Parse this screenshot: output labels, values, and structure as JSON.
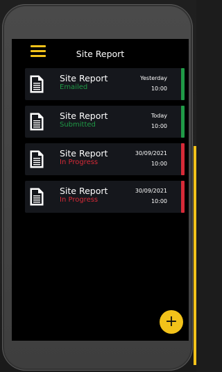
{
  "app_bar": {
    "title": "Site Report",
    "menu_icon": "hamburger-menu-icon"
  },
  "colors": {
    "accent": "#f2c21a",
    "status_complete": "#1f9a46",
    "status_in_progress": "#d62a37"
  },
  "reports": [
    {
      "title": "Site Report",
      "status": "Emailed",
      "status_color": "#1f9a46",
      "date": "Yesterday",
      "time": "10:00",
      "icon": "document-icon"
    },
    {
      "title": "Site Report",
      "status": "Submitted",
      "status_color": "#1f9a46",
      "date": "Today",
      "time": "10:00",
      "icon": "document-icon"
    },
    {
      "title": "Site Report",
      "status": "In Progress",
      "status_color": "#d62a37",
      "date": "30/09/2021",
      "time": "10:00",
      "icon": "document-icon"
    },
    {
      "title": "Site Report",
      "status": "In Progress",
      "status_color": "#d62a37",
      "date": "30/09/2021",
      "time": "10:00",
      "icon": "document-icon"
    }
  ],
  "fab": {
    "label": "+",
    "icon": "plus-icon"
  }
}
